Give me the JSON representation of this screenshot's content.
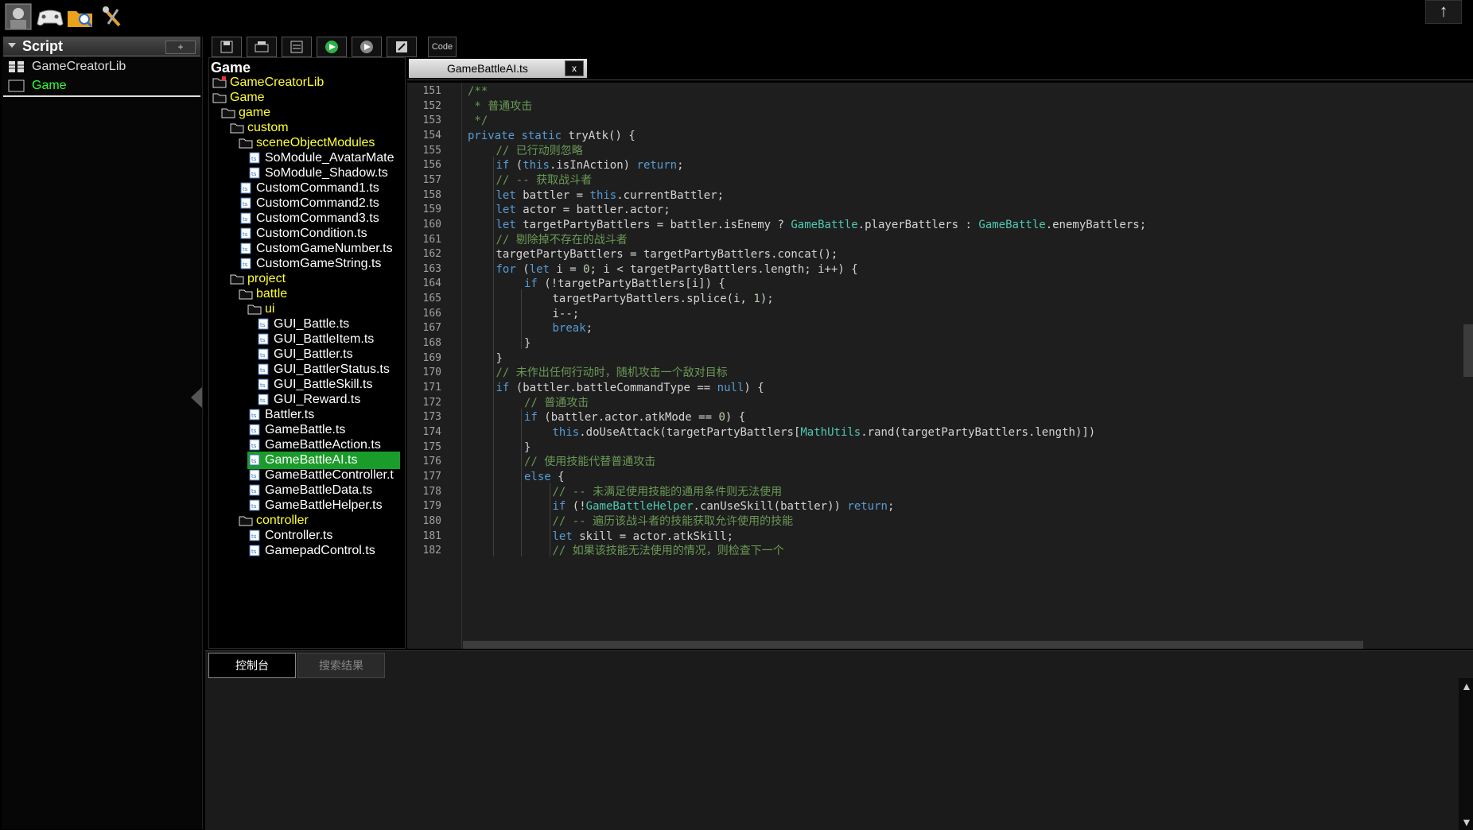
{
  "topbar": {
    "icons": [
      "avatar-icon",
      "gamepad-icon",
      "folder-search-icon",
      "tools-icon"
    ],
    "up_label": "↑"
  },
  "script_panel": {
    "title": "Script",
    "add_label": "+",
    "items": [
      {
        "label": "GameCreatorLib",
        "selected": false
      },
      {
        "label": "Game",
        "selected": true
      }
    ]
  },
  "toolbar": {
    "buttons": [
      "save-icon",
      "print-icon",
      "list-icon",
      "run-icon",
      "play-icon",
      "formula-icon"
    ],
    "code_label": "Code"
  },
  "tree": {
    "title": "Game",
    "items": [
      {
        "label": "GameCreatorLib",
        "type": "folder",
        "level": 0
      },
      {
        "label": "Game",
        "type": "folder",
        "level": 0
      },
      {
        "label": "game",
        "type": "folder",
        "level": 1
      },
      {
        "label": "custom",
        "type": "folder",
        "level": 2
      },
      {
        "label": "sceneObjectModules",
        "type": "folder",
        "level": 3
      },
      {
        "label": "SoModule_AvatarMate",
        "type": "file",
        "level": 4
      },
      {
        "label": "SoModule_Shadow.ts",
        "type": "file",
        "level": 4
      },
      {
        "label": "CustomCommand1.ts",
        "type": "file",
        "level": 3
      },
      {
        "label": "CustomCommand2.ts",
        "type": "file",
        "level": 3
      },
      {
        "label": "CustomCommand3.ts",
        "type": "file",
        "level": 3
      },
      {
        "label": "CustomCondition.ts",
        "type": "file",
        "level": 3
      },
      {
        "label": "CustomGameNumber.ts",
        "type": "file",
        "level": 3
      },
      {
        "label": "CustomGameString.ts",
        "type": "file",
        "level": 3
      },
      {
        "label": "project",
        "type": "folder",
        "level": 2
      },
      {
        "label": "battle",
        "type": "folder",
        "level": 3
      },
      {
        "label": "ui",
        "type": "folder",
        "level": 4
      },
      {
        "label": "GUI_Battle.ts",
        "type": "file",
        "level": 5
      },
      {
        "label": "GUI_BattleItem.ts",
        "type": "file",
        "level": 5
      },
      {
        "label": "GUI_Battler.ts",
        "type": "file",
        "level": 5
      },
      {
        "label": "GUI_BattlerStatus.ts",
        "type": "file",
        "level": 5
      },
      {
        "label": "GUI_BattleSkill.ts",
        "type": "file",
        "level": 5
      },
      {
        "label": "GUI_Reward.ts",
        "type": "file",
        "level": 5
      },
      {
        "label": "Battler.ts",
        "type": "file",
        "level": 4
      },
      {
        "label": "GameBattle.ts",
        "type": "file",
        "level": 4
      },
      {
        "label": "GameBattleAction.ts",
        "type": "file",
        "level": 4
      },
      {
        "label": "GameBattleAI.ts",
        "type": "file",
        "level": 4,
        "selected": true
      },
      {
        "label": "GameBattleController.t",
        "type": "file",
        "level": 4
      },
      {
        "label": "GameBattleData.ts",
        "type": "file",
        "level": 4
      },
      {
        "label": "GameBattleHelper.ts",
        "type": "file",
        "level": 4
      },
      {
        "label": "controller",
        "type": "folder",
        "level": 3
      },
      {
        "label": "Controller.ts",
        "type": "file",
        "level": 4
      },
      {
        "label": "GamepadControl.ts",
        "type": "file",
        "level": 4
      }
    ]
  },
  "editor": {
    "tab_label": "GameBattleAI.ts",
    "tab_close": "x",
    "lines": [
      {
        "n": "151",
        "i": 1,
        "t": "/**"
      },
      {
        "n": "152",
        "i": 1,
        "t": " * 普通攻击"
      },
      {
        "n": "153",
        "i": 1,
        "t": " */"
      },
      {
        "n": "154",
        "i": 1,
        "t": "private static tryAtk() {"
      },
      {
        "n": "155",
        "i": 2,
        "t": "// 已行动则忽略"
      },
      {
        "n": "156",
        "i": 2,
        "t": "if (this.isInAction) return;"
      },
      {
        "n": "157",
        "i": 2,
        "t": "// -- 获取战斗者"
      },
      {
        "n": "158",
        "i": 2,
        "t": "let battler = this.currentBattler;"
      },
      {
        "n": "159",
        "i": 2,
        "t": "let actor = battler.actor;"
      },
      {
        "n": "160",
        "i": 2,
        "t": "let targetPartyBattlers = battler.isEnemy ? GameBattle.playerBattlers : GameBattle.enemyBattlers;"
      },
      {
        "n": "161",
        "i": 2,
        "t": "// 剔除掉不存在的战斗者"
      },
      {
        "n": "162",
        "i": 2,
        "t": "targetPartyBattlers = targetPartyBattlers.concat();"
      },
      {
        "n": "163",
        "i": 2,
        "t": "for (let i = 0; i < targetPartyBattlers.length; i++) {"
      },
      {
        "n": "164",
        "i": 3,
        "t": "if (!targetPartyBattlers[i]) {"
      },
      {
        "n": "165",
        "i": 4,
        "t": "targetPartyBattlers.splice(i, 1);"
      },
      {
        "n": "166",
        "i": 4,
        "t": "i--;"
      },
      {
        "n": "167",
        "i": 4,
        "t": "break;"
      },
      {
        "n": "168",
        "i": 3,
        "t": "}"
      },
      {
        "n": "169",
        "i": 2,
        "t": "}"
      },
      {
        "n": "170",
        "i": 2,
        "t": "// 未作出任何行动时，随机攻击一个敌对目标"
      },
      {
        "n": "171",
        "i": 2,
        "t": "if (battler.battleCommandType == null) {"
      },
      {
        "n": "172",
        "i": 3,
        "t": "// 普通攻击"
      },
      {
        "n": "173",
        "i": 3,
        "t": "if (battler.actor.atkMode == 0) {"
      },
      {
        "n": "174",
        "i": 4,
        "t": "this.doUseAttack(targetPartyBattlers[MathUtils.rand(targetPartyBattlers.length)])"
      },
      {
        "n": "175",
        "i": 3,
        "t": "}"
      },
      {
        "n": "176",
        "i": 3,
        "t": "// 使用技能代替普通攻击"
      },
      {
        "n": "177",
        "i": 3,
        "t": "else {"
      },
      {
        "n": "178",
        "i": 4,
        "t": "// -- 未满足使用技能的通用条件则无法使用"
      },
      {
        "n": "179",
        "i": 4,
        "t": "if (!GameBattleHelper.canUseSkill(battler)) return;"
      },
      {
        "n": "180",
        "i": 4,
        "t": "// -- 遍历该战斗者的技能获取允许使用的技能"
      },
      {
        "n": "181",
        "i": 4,
        "t": "let skill = actor.atkSkill;"
      },
      {
        "n": "182",
        "i": 4,
        "t": "// 如果该技能无法使用的情况，则检查下一个"
      }
    ]
  },
  "console": {
    "tabs": [
      "控制台",
      "搜索结果"
    ],
    "up_arrow": "▲",
    "down_arrow": "▼"
  }
}
